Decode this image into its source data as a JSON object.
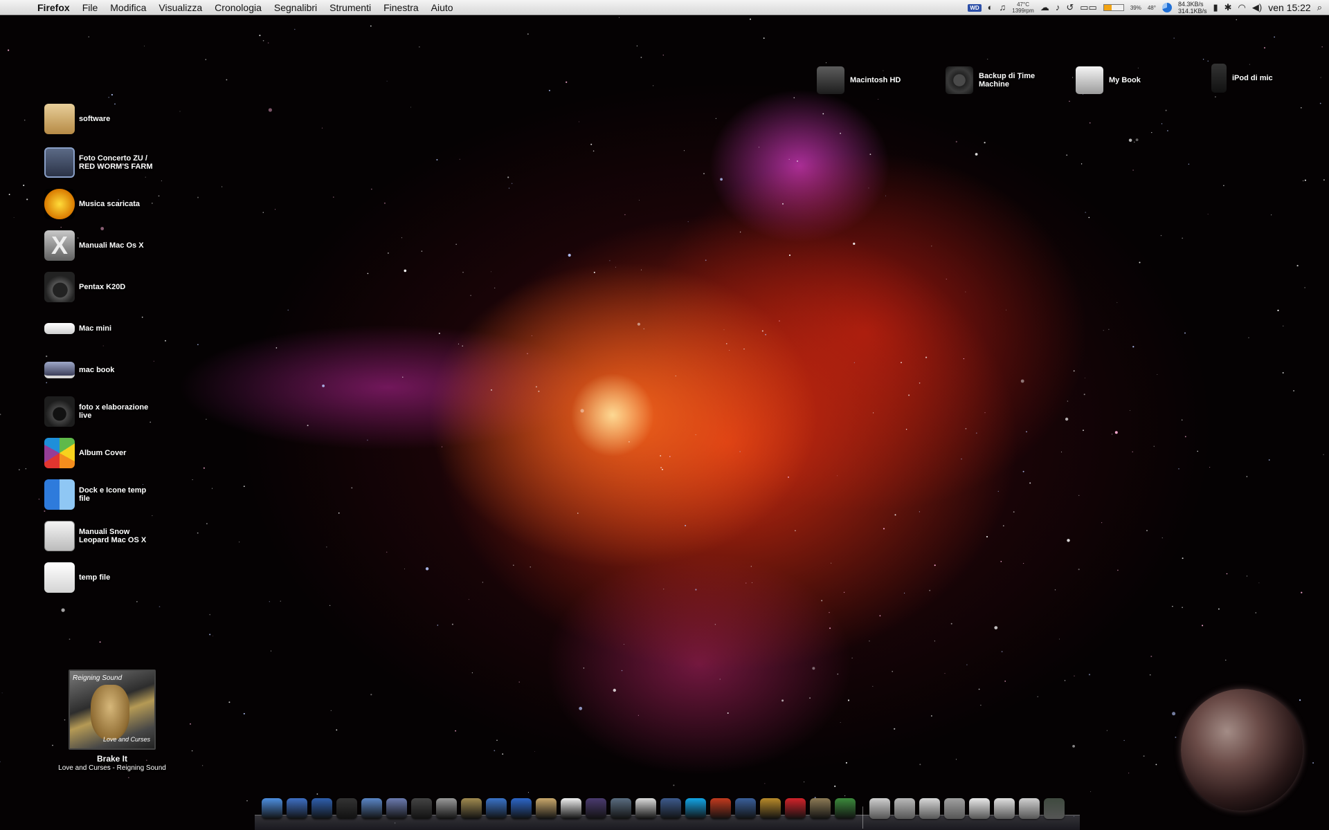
{
  "menubar": {
    "app_name": "Firefox",
    "menus": [
      "File",
      "Modifica",
      "Visualizza",
      "Cronologia",
      "Segnalibri",
      "Strumenti",
      "Finestra",
      "Aiuto"
    ],
    "status": {
      "hd_badge": "WD",
      "temp": "47°C",
      "rpm": "1399rpm",
      "battery": "39%",
      "angle": "48°",
      "net_down": "84.3KB/s",
      "net_up": "314.1KB/s",
      "clock": "ven 15:22"
    }
  },
  "desktop_icons": [
    {
      "label": "software",
      "icon": "software-folder-icon"
    },
    {
      "label": "Foto Concerto ZU / RED WORM'S FARM",
      "icon": "photo-folder-icon"
    },
    {
      "label": "Musica scaricata",
      "icon": "music-folder-icon"
    },
    {
      "label": "Manuali Mac Os X",
      "icon": "mac-os-x-icon"
    },
    {
      "label": "Pentax K20D",
      "icon": "camera-icon"
    },
    {
      "label": "Mac mini",
      "icon": "mac-mini-icon"
    },
    {
      "label": "mac book",
      "icon": "macbook-icon"
    },
    {
      "label": "foto x elaborazione live",
      "icon": "camera-icon"
    },
    {
      "label": "Album Cover",
      "icon": "apple-logo-icon"
    },
    {
      "label": "Dock e Icone temp file",
      "icon": "finder-icon"
    },
    {
      "label": "Manuali Snow Leopard Mac OS X",
      "icon": "document-icon"
    },
    {
      "label": "temp file",
      "icon": "box-icon"
    }
  ],
  "drives": [
    {
      "label": "Macintosh HD",
      "icon": "hard-drive-icon"
    },
    {
      "label": "Backup di Time Machine",
      "icon": "time-machine-icon"
    },
    {
      "label": "My Book",
      "icon": "external-drive-icon"
    },
    {
      "label": "iPod di mic",
      "icon": "ipod-icon"
    }
  ],
  "now_playing": {
    "track": "Brake It",
    "album_artist": "Love and Curses - Reigning Sound",
    "cover_title": "Reigning Sound",
    "cover_subtitle": "Love and Curses"
  },
  "dock": {
    "apps": [
      {
        "name": "finder-icon",
        "color": "#4d8fe0"
      },
      {
        "name": "preview-icon",
        "color": "#3e6fc4"
      },
      {
        "name": "xcode-icon",
        "color": "#2f5fae"
      },
      {
        "name": "camera-icon",
        "color": "#333333"
      },
      {
        "name": "gears-icon",
        "color": "#5a86c6"
      },
      {
        "name": "photos-icon",
        "color": "#6b7bb0"
      },
      {
        "name": "image-capture-icon",
        "color": "#444444"
      },
      {
        "name": "safari-icon",
        "color": "#999999"
      },
      {
        "name": "preview-person-icon",
        "color": "#a08a50"
      },
      {
        "name": "firefox-icon",
        "color": "#3a73c8"
      },
      {
        "name": "mail-stamp-icon",
        "color": "#2c66c8"
      },
      {
        "name": "address-book-icon",
        "color": "#c9a96b"
      },
      {
        "name": "ical-icon",
        "color": "#f0f0f0"
      },
      {
        "name": "photo-booth-icon",
        "color": "#4b3b6f"
      },
      {
        "name": "time-machine-icon",
        "color": "#5a6d80"
      },
      {
        "name": "mac-utility-icon",
        "color": "#dcdcdc"
      },
      {
        "name": "keychain-icon",
        "color": "#3d5a8c"
      },
      {
        "name": "skype-icon",
        "color": "#12a5e6"
      },
      {
        "name": "vlc-icon",
        "color": "#c23a1e"
      },
      {
        "name": "text-edit-icon",
        "color": "#3a5f9a"
      },
      {
        "name": "automator-icon",
        "color": "#b88a2a"
      },
      {
        "name": "lastfm-icon",
        "color": "#d2232a"
      },
      {
        "name": "portrait-app-icon",
        "color": "#8c7a55"
      },
      {
        "name": "photo-viewer-icon",
        "color": "#3c8a3c"
      }
    ],
    "stacks": [
      {
        "name": "mail-icon",
        "color": "#cfcfcf"
      },
      {
        "name": "first-aid-icon",
        "color": "#b9b9b9"
      },
      {
        "name": "document-stack-icon",
        "color": "#d8d8d8"
      },
      {
        "name": "pencil-icon",
        "color": "#a0a0a0"
      },
      {
        "name": "downloads-stack-icon",
        "color": "#e9e9e9"
      },
      {
        "name": "documents-stack-icon",
        "color": "#e0e0e0"
      },
      {
        "name": "applications-stack-icon",
        "color": "#d0d0d0"
      },
      {
        "name": "trash-icon",
        "color": "#3f4a3f"
      }
    ]
  }
}
